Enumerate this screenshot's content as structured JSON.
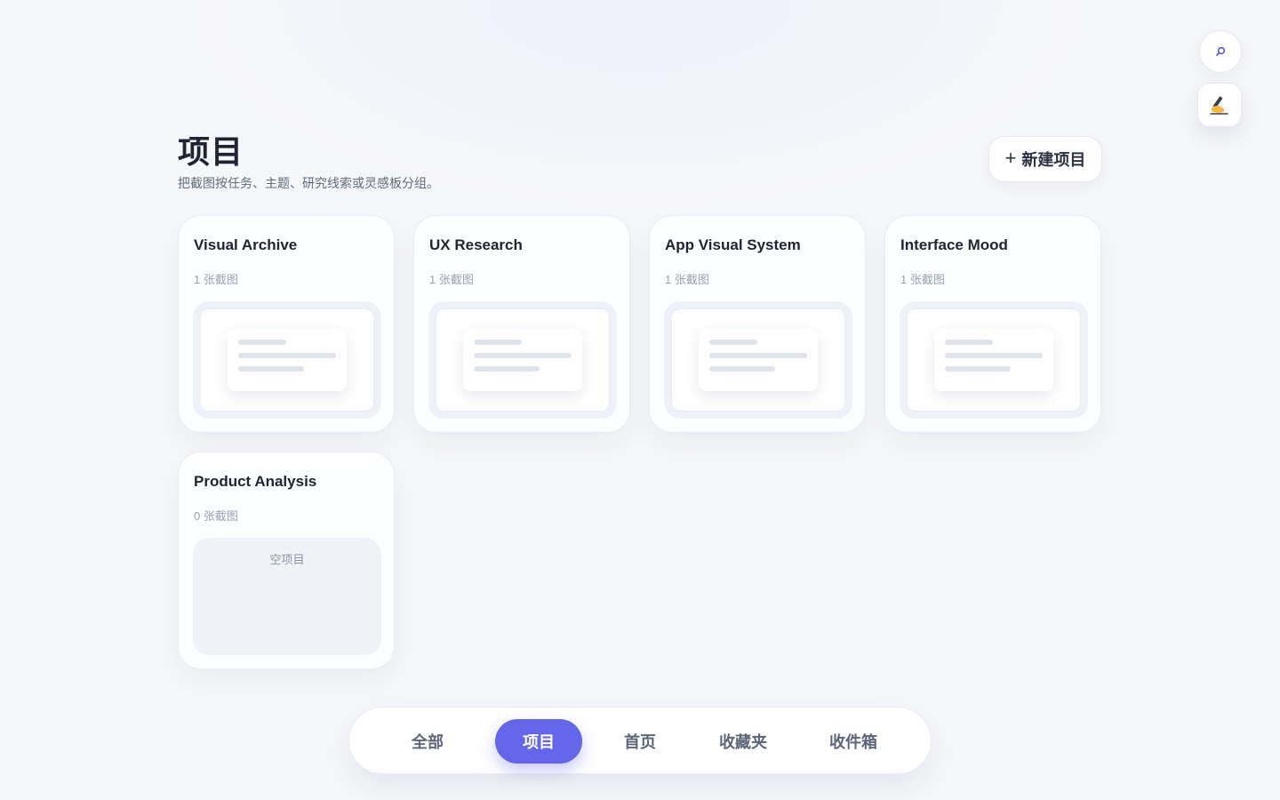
{
  "header": {
    "title": "项目",
    "subtitle": "把截图按任务、主题、研究线索或灵感板分组。",
    "new_button_plus": "+",
    "new_button_label": "新建项目"
  },
  "fab": {
    "search_icon": "search-icon",
    "pen_icon": "writing-hand-icon"
  },
  "projects": [
    {
      "name": "Visual Archive",
      "count": "1 张截图",
      "has_preview": true
    },
    {
      "name": "UX Research",
      "count": "1 张截图",
      "has_preview": true
    },
    {
      "name": "App Visual System",
      "count": "1 张截图",
      "has_preview": true
    },
    {
      "name": "Interface Mood",
      "count": "1 张截图",
      "has_preview": true
    },
    {
      "name": "Product Analysis",
      "count": "0 张截图",
      "has_preview": false,
      "empty_label": "空项目"
    }
  ],
  "nav": {
    "items": [
      {
        "label": "全部",
        "active": false
      },
      {
        "label": "项目",
        "active": true
      },
      {
        "label": "首页",
        "active": false
      },
      {
        "label": "收藏夹",
        "active": false
      },
      {
        "label": "收件箱",
        "active": false
      }
    ]
  },
  "colors": {
    "accent": "#6366e8",
    "background": "#f6f7fa",
    "text_primary": "#1f2433",
    "text_muted": "#97a1b1"
  }
}
